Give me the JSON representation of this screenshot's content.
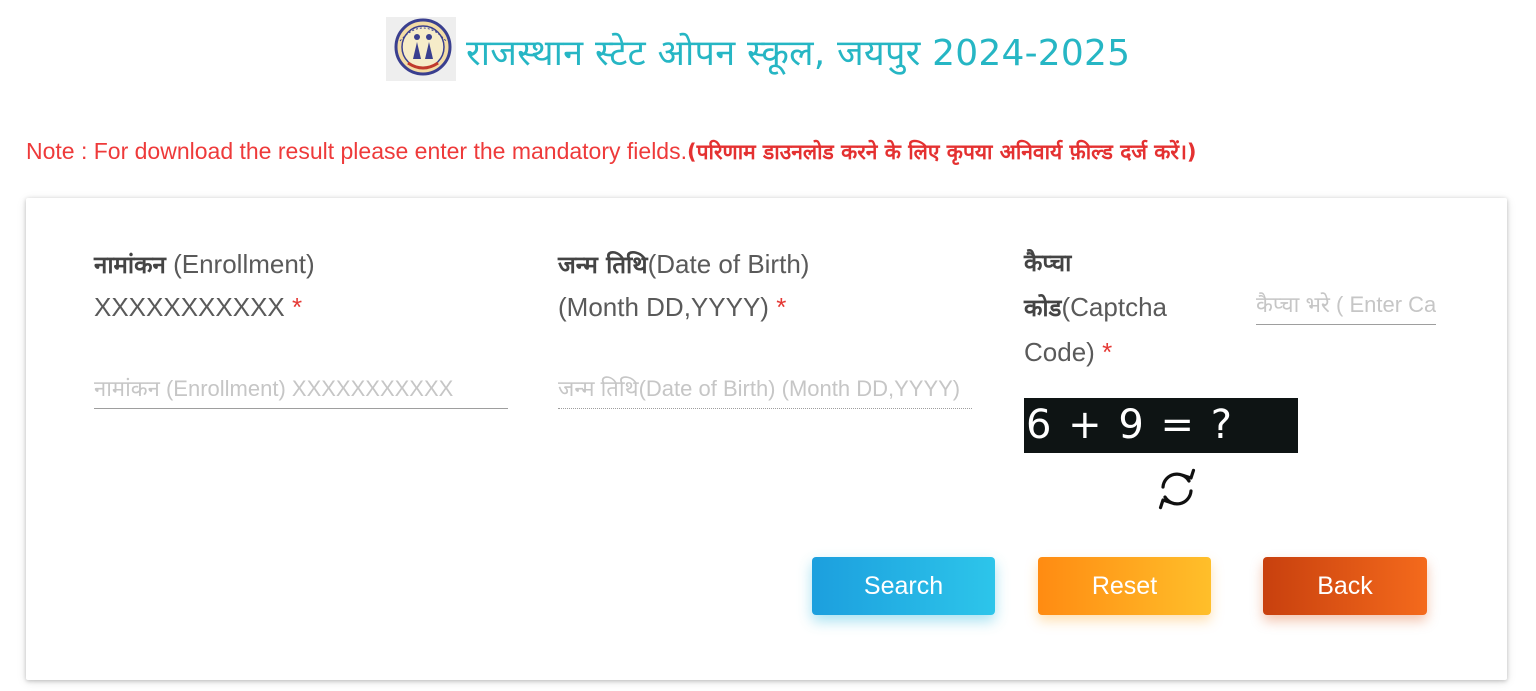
{
  "header": {
    "title": "राजस्थान स्टेट ओपन स्कूल, जयपुर 2024-2025",
    "logo_icon": "rsos-emblem-icon"
  },
  "note": {
    "english": "Note : For download the result please enter the mandatory fields.",
    "hindi": "(परिणाम डाउनलोड करने के लिए कृपया अनिवार्य फ़ील्ड दर्ज करें।)"
  },
  "form": {
    "enrollment": {
      "label_hindi": "नामांकन",
      "label_english": " (Enrollment)",
      "label_line2": "XXXXXXXXXXX",
      "required_mark": "*",
      "placeholder": "नामांकन (Enrollment) XXXXXXXXXXX",
      "value": ""
    },
    "dob": {
      "label_hindi": "जन्म तिथि",
      "label_english": "(Date of Birth)",
      "label_line2": "(Month DD,YYYY)",
      "required_mark": "*",
      "placeholder": "जन्म तिथि(Date of Birth) (Month DD,YYYY)",
      "value": ""
    },
    "captcha": {
      "label_hindi_1": "कैप्चा",
      "label_hindi_2": "कोड",
      "label_english_1": "(Captcha",
      "label_english_2": "Code)",
      "required_mark": "*",
      "placeholder": "कैप्चा भरे ( Enter Captcha )",
      "value": "",
      "question": "6 + 9 = ?",
      "refresh_icon": "refresh-icon"
    }
  },
  "buttons": {
    "search": "Search",
    "reset": "Reset",
    "back": "Back"
  },
  "colors": {
    "title": "#26b6c4",
    "note": "#ee3a3a",
    "search": "#1c9fde",
    "reset": "#ff8b12",
    "back": "#c8400e",
    "captcha_bg": "#0e1414"
  }
}
